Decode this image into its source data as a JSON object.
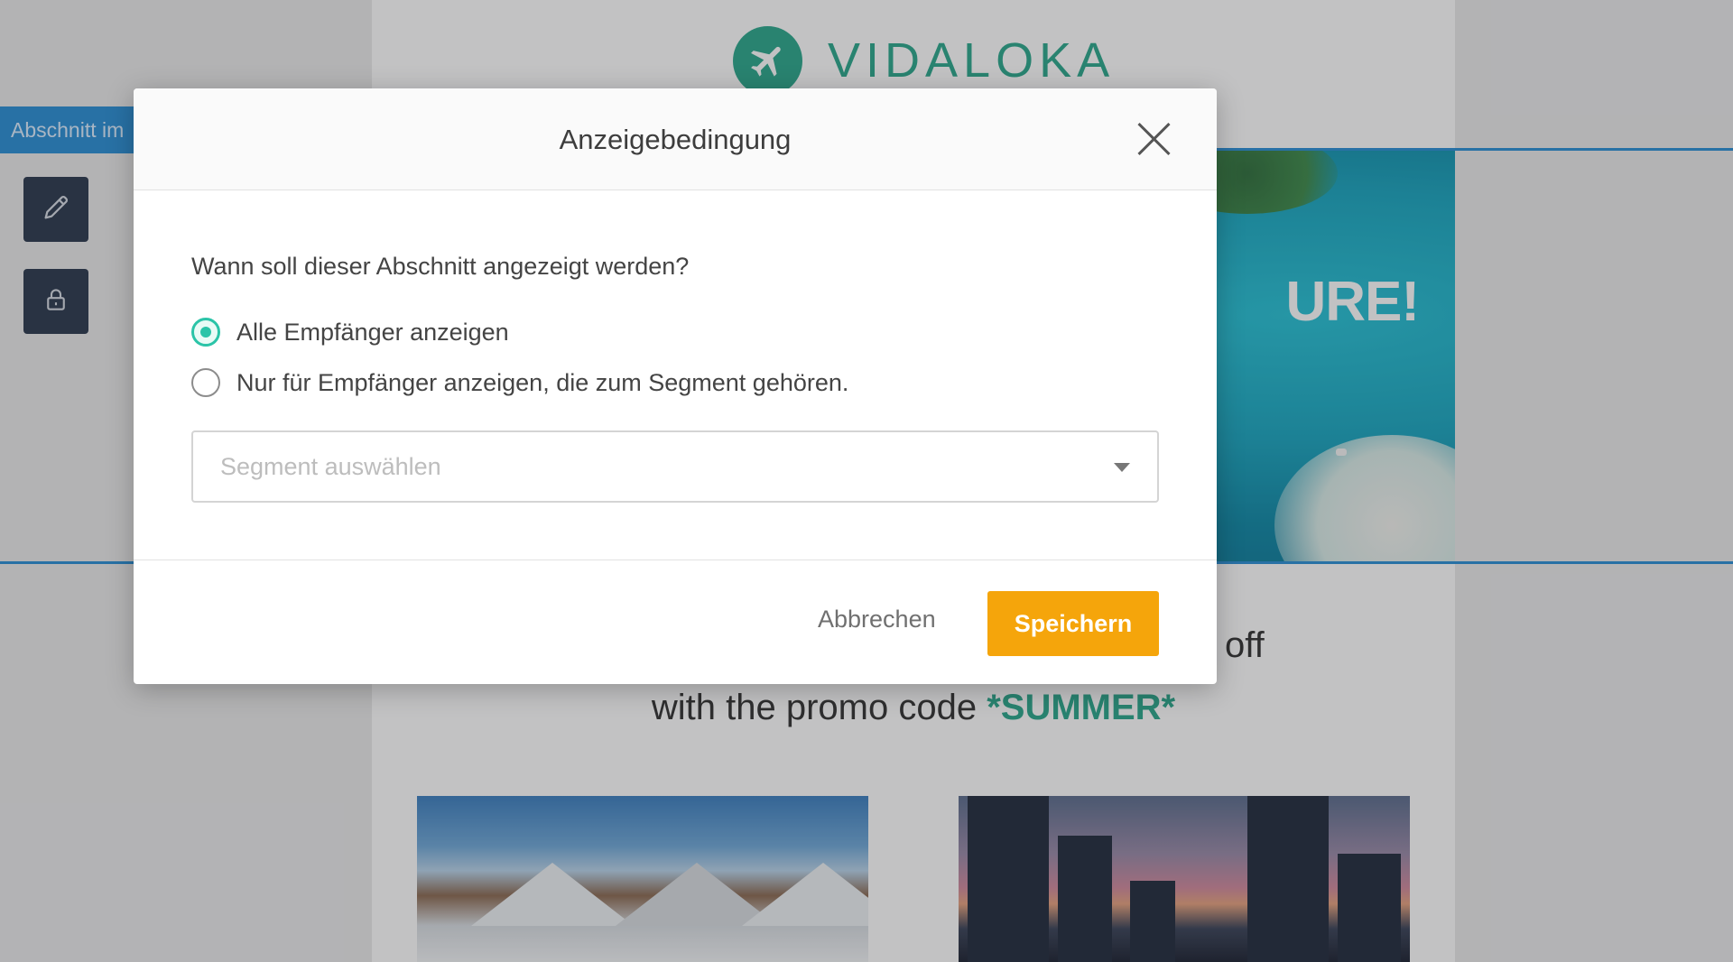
{
  "app": {
    "section_tag": "Abschnitt im",
    "brand_name": "VIDALOKA",
    "hero_text": "URE!",
    "promo_off": "off",
    "promo_prefix": "with the promo code ",
    "promo_code": "*SUMMER*",
    "colors": {
      "brand": "#2ba88d",
      "selection": "#2a8fd6",
      "save": "#f5a50b",
      "radio_active": "#2bc4a8"
    }
  },
  "toolbar": {
    "edit_icon": "pencil-icon",
    "lock_icon": "lock-icon"
  },
  "modal": {
    "title": "Anzeigebedingung",
    "close_icon": "close-icon",
    "question": "Wann soll dieser Abschnitt angezeigt werden?",
    "options": [
      {
        "label": "Alle Empfänger anzeigen",
        "checked": true
      },
      {
        "label": "Nur für Empfänger anzeigen, die zum Segment gehören.",
        "checked": false
      }
    ],
    "segment_select": {
      "placeholder": "Segment auswählen",
      "caret_icon": "caret-down-icon"
    },
    "cancel_label": "Abbrechen",
    "save_label": "Speichern"
  }
}
